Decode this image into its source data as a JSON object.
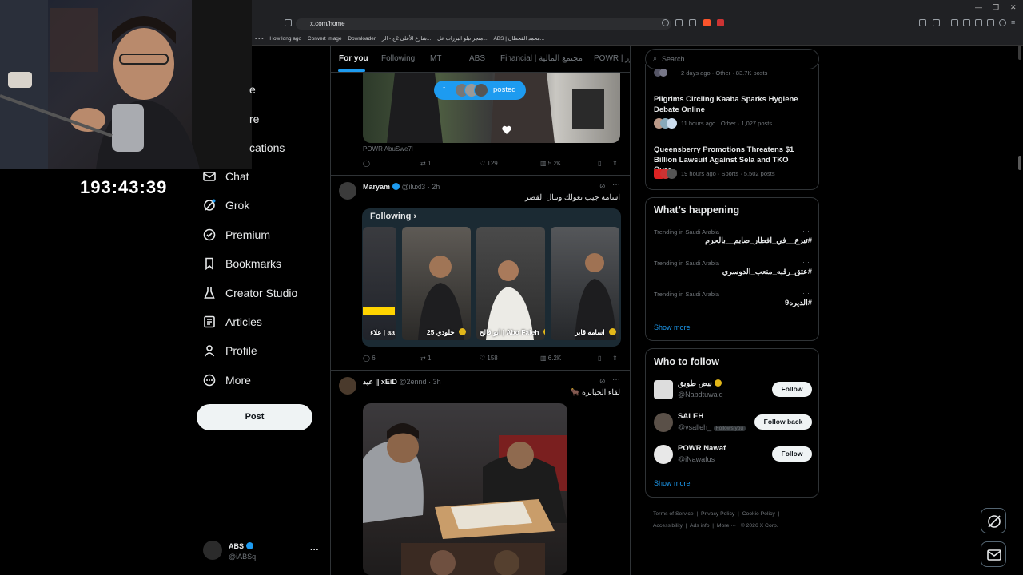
{
  "browser": {
    "url": "x.com/home",
    "bookmarks": [
      "How long ago",
      "Convert Image",
      "Downloader",
      "شارع الأعلى 2ج - الر...",
      "متجر نبلو البزرات عل...",
      "ABS | محمد القحطان..."
    ]
  },
  "stream": {
    "timer": "193:43:39"
  },
  "nav": {
    "partial_items": [
      "e",
      "re",
      "cations"
    ],
    "items": [
      "Chat",
      "Grok",
      "Premium",
      "Bookmarks",
      "Creator Studio",
      "Articles",
      "Profile",
      "More"
    ],
    "post_label": "Post"
  },
  "account": {
    "name": "ABS",
    "handle": "@iABSq"
  },
  "feed": {
    "tabs": [
      "For you",
      "Following",
      "MT",
      "ABS",
      "Financial | مجتمع المالية",
      "POWR | ور"
    ],
    "posted_pill": "posted",
    "tweet0": {
      "caption": "POWR AbuSwe7l",
      "stats": {
        "replies": "",
        "retweets": "1",
        "likes": "129",
        "views": "5.2K"
      }
    },
    "tweet1": {
      "name": "Maryam",
      "handle": "@iluxl3",
      "time": "2h",
      "text": "اسامه جيب تعولك وتنال القصر",
      "following_label": "Following",
      "thumbs": [
        "علاء | aa",
        "خلودي 25",
        "ابو فالح | Abo Faleh",
        "اسامه قاير"
      ],
      "stats": {
        "replies": "6",
        "retweets": "1",
        "likes": "158",
        "views": "6.2K"
      }
    },
    "tweet2": {
      "name": "عبد || xEiD",
      "handle": "@2ennd",
      "time": "3h",
      "text": "لقاء الجبابرة 🐂"
    }
  },
  "sidebar": {
    "search_placeholder": "Search",
    "trends_top": [
      {
        "meta": "2 days ago · Other · 83.7K posts"
      },
      {
        "title": "Pilgrims Circling Kaaba Sparks Hygiene Debate Online",
        "meta": "11 hours ago · Other · 1,027 posts"
      },
      {
        "title": "Queensberry Promotions Threatens $1 Billion Lawsuit Against Sela and TKO Over...",
        "meta": "19 hours ago · Sports · 5,502 posts"
      }
    ],
    "whats_happening": {
      "title": "What’s happening",
      "items": [
        {
          "context": "Trending in Saudi Arabia",
          "tag": "#تبرع__في_افطار_صايم__بالحرم"
        },
        {
          "context": "Trending in Saudi Arabia",
          "tag": "#عتق_رقبه_منعب_الدوسري"
        },
        {
          "context": "Trending in Saudi Arabia",
          "tag": "#الديره9"
        }
      ],
      "show_more": "Show more"
    },
    "who_to_follow": {
      "title": "Who to follow",
      "items": [
        {
          "name": "نبض طويق",
          "handle": "@Nabdtuwaiq",
          "button": "Follow",
          "follows_you": ""
        },
        {
          "name": "SALEH",
          "handle": "@vsalleh_",
          "button": "Follow back",
          "follows_you": "Follows you"
        },
        {
          "name": "POWR Nawaf",
          "handle": "@iNawafus",
          "button": "Follow",
          "follows_you": ""
        }
      ],
      "show_more": "Show more"
    },
    "footer": [
      "Terms of Service",
      "Privacy Policy",
      "Cookie Policy",
      "Accessibility",
      "Ads info",
      "More ···",
      "© 2026 X Corp."
    ]
  },
  "colors": {
    "accent": "#1d9bf0",
    "bg": "#000000",
    "border": "#2f3336",
    "muted": "#71767b",
    "gold": "#e2b719"
  }
}
